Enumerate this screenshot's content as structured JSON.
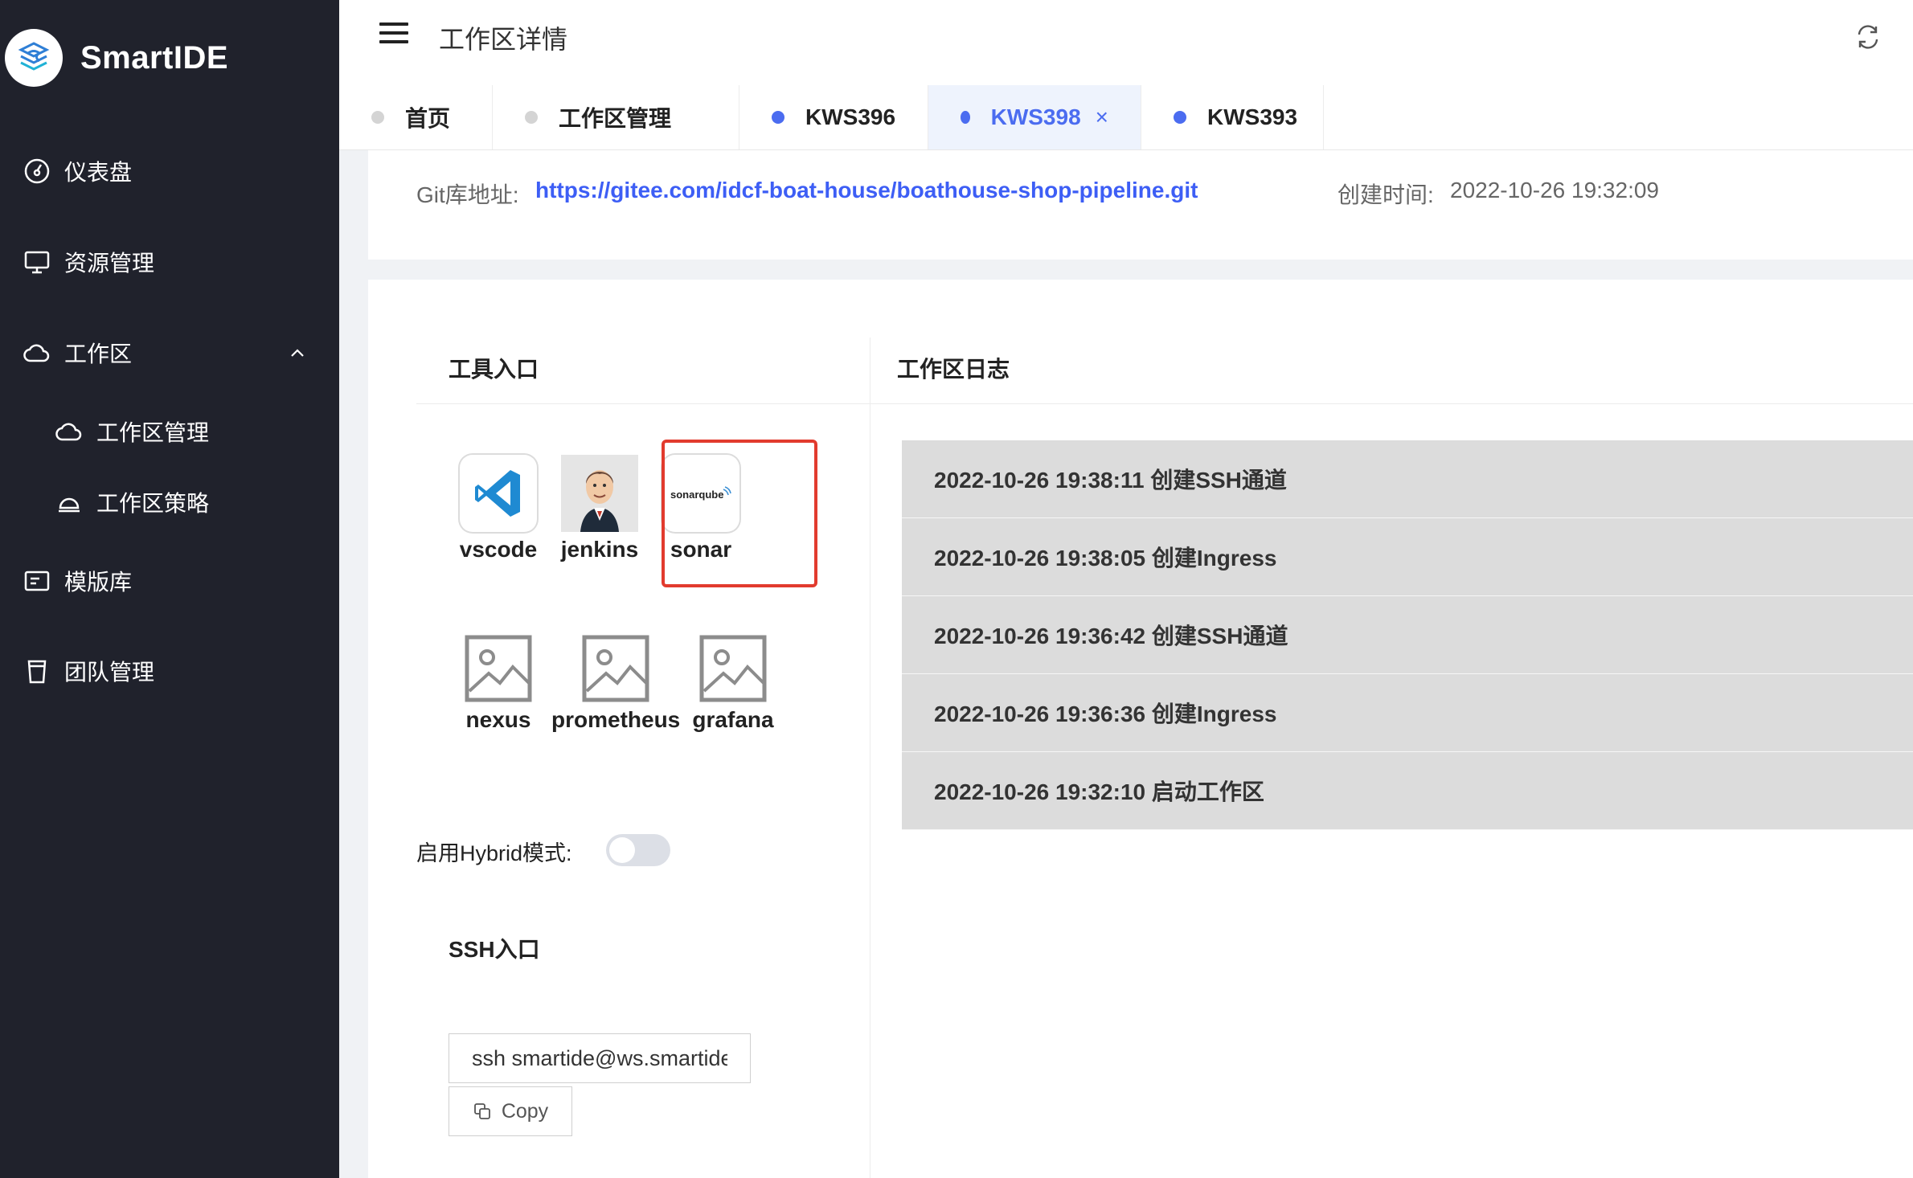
{
  "brand": {
    "name": "SmartIDE"
  },
  "sidebar": {
    "items": [
      {
        "label": "仪表盘",
        "icon": "dashboard-icon"
      },
      {
        "label": "资源管理",
        "icon": "monitor-icon"
      },
      {
        "label": "工作区",
        "icon": "cloud-icon",
        "expanded": true
      },
      {
        "label": "工作区管理",
        "icon": "cloud-icon",
        "sub": true
      },
      {
        "label": "工作区策略",
        "icon": "bell-icon",
        "sub": true
      },
      {
        "label": "模版库",
        "icon": "template-icon"
      },
      {
        "label": "团队管理",
        "icon": "cup-icon"
      }
    ]
  },
  "header": {
    "title": "工作区详情",
    "refresh_icon": "refresh-icon",
    "menu_icon": "hamburger-icon"
  },
  "tabs": [
    {
      "label": "首页",
      "dot_color": "#d4d4d4",
      "active": false
    },
    {
      "label": "工作区管理",
      "dot_color": "#d4d4d4",
      "active": false
    },
    {
      "label": "KWS396",
      "dot_color": "#4b6cf0",
      "active": false
    },
    {
      "label": "KWS398",
      "dot_color": "#4b6cf0",
      "active": true,
      "close": "×"
    },
    {
      "label": "KWS393",
      "dot_color": "#4b6cf0",
      "active": false
    }
  ],
  "info": {
    "git_label": "Git库地址:",
    "git_url": "https://gitee.com/idcf-boat-house/boathouse-shop-pipeline.git",
    "created_label": "创建时间:",
    "created_value": "2022-10-26 19:32:09"
  },
  "tools": {
    "title": "工具入口",
    "items": [
      {
        "label": "vscode",
        "icon": "vscode-icon"
      },
      {
        "label": "jenkins",
        "icon": "jenkins-icon"
      },
      {
        "label": "sonar",
        "icon": "sonarqube-icon",
        "icon_text": "sonarqube"
      },
      {
        "label": "nexus",
        "icon": "image-placeholder-icon"
      },
      {
        "label": "prometheus",
        "icon": "image-placeholder-icon"
      },
      {
        "label": "grafana",
        "icon": "image-placeholder-icon"
      }
    ]
  },
  "hybrid": {
    "label": "启用Hybrid模式:",
    "enabled": false
  },
  "ssh": {
    "title": "SSH入口",
    "command": "ssh smartide@ws.smartide.cn",
    "copy_label": "Copy"
  },
  "logs": {
    "title": "工作区日志",
    "items": [
      "2022-10-26 19:38:11 创建SSH通道",
      "2022-10-26 19:38:05 创建Ingress",
      "2022-10-26 19:36:42 创建SSH通道",
      "2022-10-26 19:36:36 创建Ingress",
      "2022-10-26 19:32:10 启动工作区"
    ]
  },
  "colors": {
    "sidebar_bg": "#20222c",
    "accent": "#4b6cf0",
    "link": "#3d5ef5",
    "highlight": "#e23b2e"
  }
}
